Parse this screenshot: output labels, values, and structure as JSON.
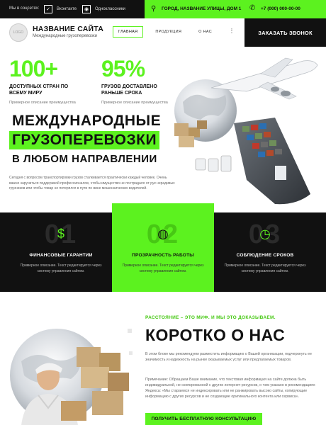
{
  "topbar": {
    "social_label": "Мы в соцсетях:",
    "socials": [
      {
        "icon": "vk-icon",
        "glyph": "✓",
        "label": "Вконтакте"
      },
      {
        "icon": "ok-icon",
        "glyph": "◉",
        "label": "Одноклассники"
      }
    ],
    "address": "ГОРОД, НАЗВАНИЕ УЛИЦЫ, ДОМ 1",
    "phone": "+7 (000) 000-00-00",
    "accent": "#5cf21f"
  },
  "header": {
    "logo_text": "LOGO",
    "site_name": "НАЗВАНИЕ САЙТА",
    "site_desc": "Международные грузоперевозки",
    "nav": [
      "ГЛАВНАЯ",
      "ПРОДУКЦИЯ",
      "О НАС"
    ],
    "more": "⋮",
    "callback": "ЗАКАЗАТЬ ЗВОНОК"
  },
  "hero": {
    "stats": [
      {
        "num": "100+",
        "label1": "ДОСТУПНЫХ СТРАН ПО",
        "label2": "ВСЕМУ МИРУ",
        "sub": "Примерное описание преимущества"
      },
      {
        "num": "95%",
        "label1": "ГРУЗОВ ДОСТАВЛЕНО",
        "label2": "РАНЬШЕ СРОКА",
        "sub": "Примерное описание преимущества"
      }
    ],
    "title_line1": "МЕЖДУНАРОДНЫЕ",
    "title_line2": "ГРУЗОПЕРЕВОЗКИ",
    "title_line3": "В ЛЮБОМ НАПРАВЛЕНИИ",
    "text": "Сегодня с вопросом транспортировки грузов сталкивается практически каждый человек. Очень важно заручиться поддержкой профессионалов, чтобы имущество не пострадало от рук нерадивых грузчиков или чтобы товар не потерялся в пути по вине мошеннических водителей."
  },
  "features": [
    {
      "num": "01",
      "icon": "money-bag-icon",
      "glyph": "$",
      "title": "ФИНАНСОВЫЕ ГАРАНТИИ",
      "text": "Примерное описание. Текст редактируется через систему управления сайтом."
    },
    {
      "num": "02",
      "icon": "globe-icon",
      "glyph": "◍",
      "title": "ПРОЗРАЧНОСТЬ РАБОТЫ",
      "text": "Примерное описание. Текст редактируется через систему управления сайтом."
    },
    {
      "num": "03",
      "icon": "stopwatch-icon",
      "glyph": "◷",
      "title": "СОБЛЮДЕНИЕ СРОКОВ",
      "text": "Примерное описание. Текст редактируется через систему управления сайтом."
    }
  ],
  "about": {
    "kicker": "РАССТОЯНИЕ – ЭТО МИФ. И МЫ ЭТО ДОКАЗЫВАЕМ.",
    "title": "КОРОТКО О НАС",
    "p1": "В этом блоке мы рекомендуем разместить информацию о Вашей организации, подчеркнуть ее значимость и надежность на рынке оказываемых услуг или предлагаемых товаров.",
    "p2": "Примечание: Обращаем Ваше внимание, что текстовая информация на сайте должна быть индивидуальной, не скопированной с других интернет-ресурсов, о чем указано в рекомендациях Яндекса: «Мы стараемся не индексировать или не ранжировать высоко сайты, копирующие информацию с других ресурсов и не создающие оригинального контента или сервиса».",
    "button": "ПОЛУЧИТЬ БЕСПЛАТНУЮ КОНСУЛЬТАЦИЮ"
  }
}
